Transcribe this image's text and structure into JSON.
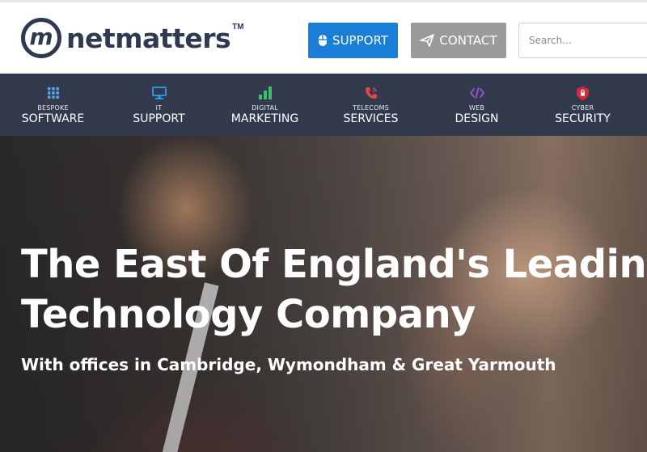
{
  "header": {
    "logo_mark": "m",
    "logo_text": "netmatters",
    "logo_tm": "TM",
    "support_label": "SUPPORT",
    "contact_label": "CONTACT",
    "search_placeholder": "Search..."
  },
  "nav": {
    "items": [
      {
        "small": "BESPOKE",
        "big": "SOFTWARE",
        "icon": "grid-icon",
        "color": "#5aa7e6"
      },
      {
        "small": "IT",
        "big": "SUPPORT",
        "icon": "monitor-icon",
        "color": "#2f8fe0"
      },
      {
        "small": "DIGITAL",
        "big": "MARKETING",
        "icon": "bar-chart-icon",
        "color": "#3fbf6a"
      },
      {
        "small": "TELECOMS",
        "big": "SERVICES",
        "icon": "phone-icon",
        "color": "#e04a3a"
      },
      {
        "small": "WEB",
        "big": "DESIGN",
        "icon": "code-icon",
        "color": "#9b59d0"
      },
      {
        "small": "CYBER",
        "big": "SECURITY",
        "icon": "shield-icon",
        "color": "#e0243a"
      }
    ]
  },
  "hero": {
    "title_line1": "The East Of England's Leading",
    "title_line2": "Technology Company",
    "subtitle": "With offices in Cambridge, Wymondham & Great Yarmouth"
  },
  "colors": {
    "brand": "#2f3a52",
    "support_button": "#1a7ed6",
    "contact_button": "#9b9b9b",
    "nav_background": "#333a4d"
  }
}
